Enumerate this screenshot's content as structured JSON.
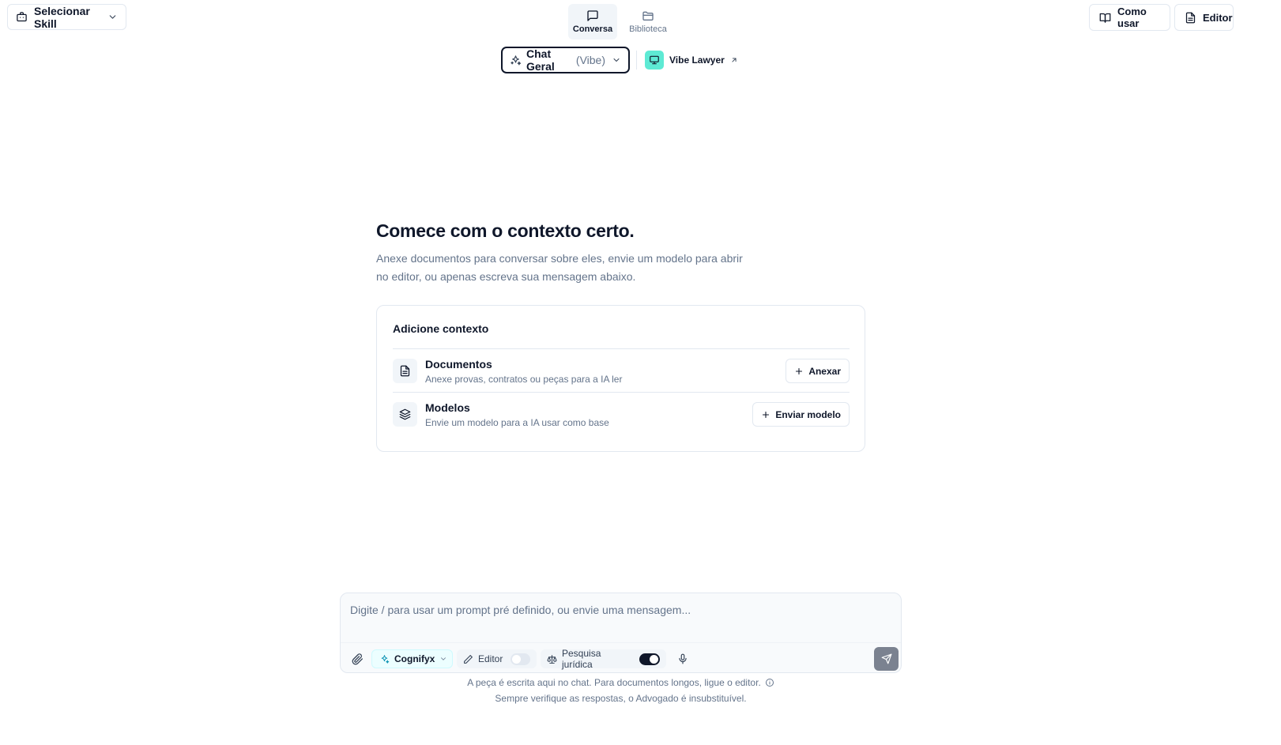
{
  "header": {
    "skill_selector": "Selecionar Skill",
    "tabs": [
      {
        "label": "Conversa",
        "active": true
      },
      {
        "label": "Biblioteca",
        "active": false
      }
    ],
    "right_buttons": {
      "como_usar": "Como usar",
      "editor": "Editor"
    }
  },
  "mode": {
    "name": "Chat Geral",
    "variant": "(Vibe)",
    "link_label": "Vibe Lawyer"
  },
  "hero": {
    "title": "Comece com o contexto certo.",
    "description": "Anexe documentos para conversar sobre eles, envie um modelo para abrir no editor, ou apenas escreva sua mensagem abaixo."
  },
  "context_card": {
    "title": "Adicione contexto",
    "rows": [
      {
        "name": "Documentos",
        "description": "Anexe provas, contratos ou peças para a IA ler",
        "action": "Anexar",
        "icon": "file-text-icon"
      },
      {
        "name": "Modelos",
        "description": "Envie um modelo para a IA usar como base",
        "action": "Enviar modelo",
        "icon": "layers-icon"
      }
    ]
  },
  "composer": {
    "placeholder": "Digite / para usar um prompt pré definido, ou envie uma mensagem...",
    "value": "",
    "model": "Cognifyx",
    "editor_label": "Editor",
    "editor_on": false,
    "research_label": "Pesquisa jurídica",
    "research_on": true
  },
  "footer": {
    "line1": "A peça é escrita aqui no chat. Para documentos longos, ligue o editor.",
    "line2": "Sempre verifique as respostas, o Advogado é insubstituível."
  },
  "colors": {
    "accent_teal": "#5eead4",
    "text_primary": "#0f172a",
    "text_muted": "#64748b",
    "border": "#e2e8f0"
  }
}
